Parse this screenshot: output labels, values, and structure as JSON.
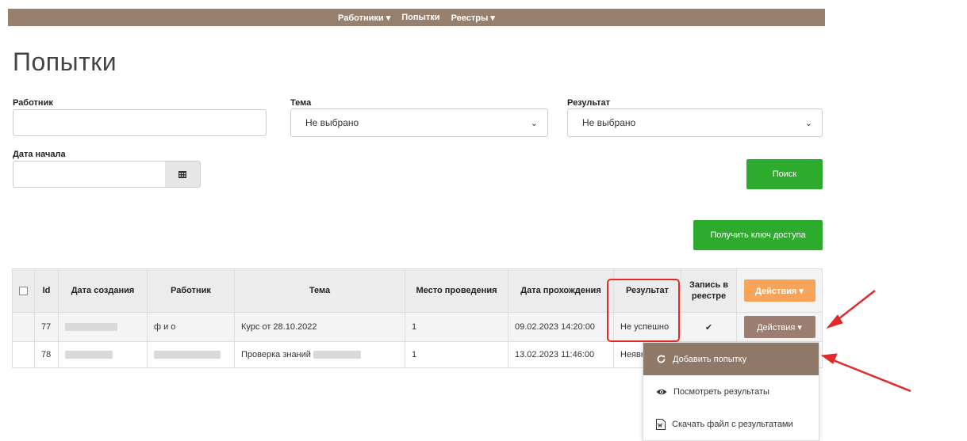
{
  "nav": {
    "items": [
      {
        "label": "Работники ▾"
      },
      {
        "label": "Попытки"
      },
      {
        "label": "Реестры ▾"
      }
    ]
  },
  "page": {
    "title": "Попытки"
  },
  "filters": {
    "employee": {
      "label": "Работник",
      "value": ""
    },
    "topic": {
      "label": "Тема",
      "selected": "Не выбрано"
    },
    "result": {
      "label": "Результат",
      "selected": "Не выбрано"
    },
    "start_date": {
      "label": "Дата начала",
      "value": ""
    },
    "search_button": "Поиск",
    "access_key_button": "Получить ключ доступа"
  },
  "table": {
    "headers": {
      "id": "Id",
      "created": "Дата создания",
      "employee": "Работник",
      "topic": "Тема",
      "place": "Место проведения",
      "passed": "Дата прохождения",
      "result": "Результат",
      "registry": "Запись в реестре",
      "actions": "Действия ▾"
    },
    "rows": [
      {
        "id": "77",
        "employee": "ф и о",
        "topic": "Курс от 28.10.2022",
        "place": "1",
        "passed": "09.02.2023 14:20:00",
        "result": "Не успешно",
        "registry": "✔",
        "actions": "Действия ▾"
      },
      {
        "id": "78",
        "employee": "",
        "topic": "Проверка знаний",
        "place": "1",
        "passed": "13.02.2023 11:46:00",
        "result": "Неявка",
        "registry": "",
        "actions": ""
      }
    ]
  },
  "menu": {
    "items": [
      {
        "label": "Добавить попытку",
        "icon": "refresh-icon"
      },
      {
        "label": "Посмотреть результаты",
        "icon": "eye-icon"
      },
      {
        "label": "Скачать файл с результатами",
        "icon": "word-file-icon"
      }
    ]
  },
  "colors": {
    "nav": "#97806e",
    "green": "#2dab2d",
    "orange": "#f7a45a",
    "brown": "#9b7e6f",
    "annotation": "#e12b2b"
  }
}
